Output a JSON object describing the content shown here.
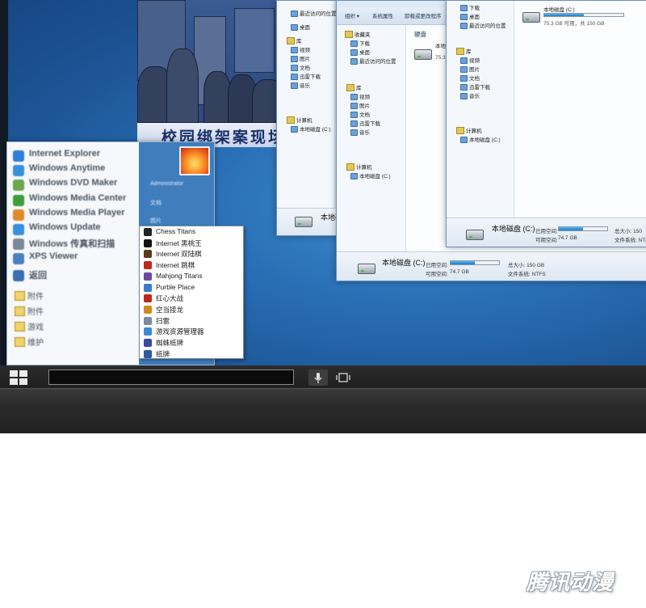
{
  "explorer_back": {
    "nav": [
      "最近访问的位置"
    ],
    "toolbar": [
      "下载",
      "桌面"
    ],
    "drive": {
      "name": "本地磁盘 (C:)",
      "free_text": "75.3 GB 可用，共 150 GB"
    },
    "library_items": [
      "下载",
      "桌面",
      "最近访问的位置"
    ],
    "library_title": "库",
    "libs": [
      "视频",
      "图片",
      "文档",
      "迅雷下载",
      "音乐"
    ],
    "computer": "计算机",
    "computer_item": "本地磁盘 (C:)",
    "status": {
      "name": "本地磁盘 (C:)",
      "used_label": "已用空间:",
      "size_label": "总大小: 150",
      "free_label": "可用空间:",
      "free_value": "74.7 GB",
      "fs_label": "文件系统: NTFS",
      "used_fraction": 0.5
    }
  },
  "explorer_mid": {
    "toolbar": [
      "组织 ▾",
      "系统属性",
      "卸载或更改程序"
    ],
    "fav_title": "收藏夹",
    "favs": [
      "下载",
      "桌面",
      "最近访问的位置"
    ],
    "lib_title": "库",
    "libs": [
      "视频",
      "图片",
      "文档",
      "迅雷下载",
      "音乐"
    ],
    "computer": "计算机",
    "computer_item": "本地磁盘 (C:)",
    "section": "硬盘",
    "drive_label": "本地",
    "drive_small": "75.3",
    "status": {
      "name": "本地磁盘 (C:)",
      "used_label": "已用空间:",
      "size_label": "总大小: 150 GB",
      "free_label": "可用空间:",
      "free_value": "74.7 GB",
      "fs_label": "文件系统: NTFS",
      "used_fraction": 0.5
    }
  },
  "explorer_far": {
    "favs": [
      "最近访问的位置"
    ],
    "lib_title": "库",
    "libs": [
      "视频",
      "图片",
      "文档",
      "迅雷下载",
      "音乐"
    ],
    "computer": "计算机",
    "computer_item": "本地磁盘 (C:)",
    "status_name": "本地磁盘"
  },
  "poster": {
    "banner": "校园绑架案现场"
  },
  "start_menu": {
    "programs": [
      {
        "label": "Internet Explorer",
        "color": "#2f7fd8"
      },
      {
        "label": "Windows Anytime",
        "color": "#3a8fdc"
      },
      {
        "label": "Windows DVD Maker",
        "color": "#6aa84f"
      },
      {
        "label": "Windows Media Center",
        "color": "#3d9d3b"
      },
      {
        "label": "Windows Media Player",
        "color": "#e08a2a"
      },
      {
        "label": "Windows Update",
        "color": "#3a8fdc"
      },
      {
        "label": "Windows 传真和扫描",
        "color": "#7a8a9a"
      },
      {
        "label": "XPS Viewer",
        "color": "#4a7fc0"
      },
      {
        "label": "返回",
        "color": "#3a6fb0"
      }
    ],
    "folders": [
      "附件",
      "附件",
      "游戏",
      "维护"
    ],
    "right_items": [
      "Administrator",
      "文档",
      "图片"
    ]
  },
  "games": [
    {
      "label": "Chess Titans",
      "color": "#222222"
    },
    {
      "label": "Internet 黑桃王",
      "color": "#111111"
    },
    {
      "label": "Internet 双陆棋",
      "color": "#5a3a1a"
    },
    {
      "label": "Internet 跳棋",
      "color": "#c0281c"
    },
    {
      "label": "Mahjong Titans",
      "color": "#6a4aa0"
    },
    {
      "label": "Purble Place",
      "color": "#3a7ad0"
    },
    {
      "label": "红心大战",
      "color": "#c0281c"
    },
    {
      "label": "空当接龙",
      "color": "#d08a20"
    },
    {
      "label": "扫雷",
      "color": "#7a8aa0"
    },
    {
      "label": "游戏资源管理器",
      "color": "#3a8ad8"
    },
    {
      "label": "蜘蛛纸牌",
      "color": "#3a4aa0"
    },
    {
      "label": "纸牌",
      "color": "#2a5aa0"
    }
  ],
  "watermark": "腾讯动漫"
}
